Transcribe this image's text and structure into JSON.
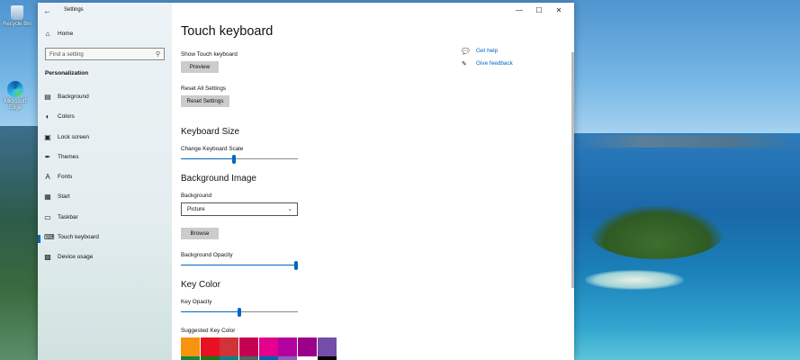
{
  "desktop": {
    "icons": [
      {
        "name": "recycle-bin",
        "label": "Recycle Bin"
      },
      {
        "name": "microsoft-edge",
        "label": "Microsoft Edge"
      }
    ]
  },
  "window": {
    "title": "Settings",
    "controls": {
      "minimize": "—",
      "maximize": "☐",
      "close": "✕"
    }
  },
  "sidebar": {
    "home_label": "Home",
    "search_placeholder": "Find a setting",
    "section": "Personalization",
    "items": [
      {
        "label": "Background",
        "icon": "picture-icon"
      },
      {
        "label": "Colors",
        "icon": "palette-icon"
      },
      {
        "label": "Lock screen",
        "icon": "lock-screen-icon"
      },
      {
        "label": "Themes",
        "icon": "brush-icon"
      },
      {
        "label": "Fonts",
        "icon": "font-icon"
      },
      {
        "label": "Start",
        "icon": "start-icon"
      },
      {
        "label": "Taskbar",
        "icon": "taskbar-icon"
      },
      {
        "label": "Touch keyboard",
        "icon": "keyboard-icon",
        "active": true
      },
      {
        "label": "Device usage",
        "icon": "device-usage-icon"
      }
    ]
  },
  "main": {
    "title": "Touch keyboard",
    "show_keyboard_label": "Show Touch keyboard",
    "preview_button": "Preview",
    "reset_label": "Reset All Settings",
    "reset_button": "Reset Settings",
    "keyboard_size_header": "Keyboard Size",
    "keyboard_scale_label": "Change Keyboard Scale",
    "keyboard_scale_value": 0.45,
    "background_image_header": "Background Image",
    "background_label": "Background",
    "background_value": "Picture",
    "browse_button": "Browse",
    "background_opacity_label": "Background Opacity",
    "background_opacity_value": 1.0,
    "key_color_header": "Key Color",
    "key_opacity_label": "Key Opacity",
    "key_opacity_value": 0.5,
    "suggested_key_color_label": "Suggested Key Color",
    "swatch_colors_row1": [
      "#f7930f",
      "#e81123",
      "#d13438",
      "#c30052",
      "#e3008c",
      "#b4009e",
      "#9a0089",
      "#744da9"
    ],
    "swatch_colors_row2": [
      "#10893e",
      "#107c10",
      "#038387",
      "#486860",
      "#0063b1",
      "#8764b8",
      "#ffffff",
      "#000000"
    ]
  },
  "help": {
    "get_help": "Get help",
    "give_feedback": "Give feedback"
  },
  "colors": {
    "accent": "#0067c0",
    "button": "#cccccc"
  }
}
